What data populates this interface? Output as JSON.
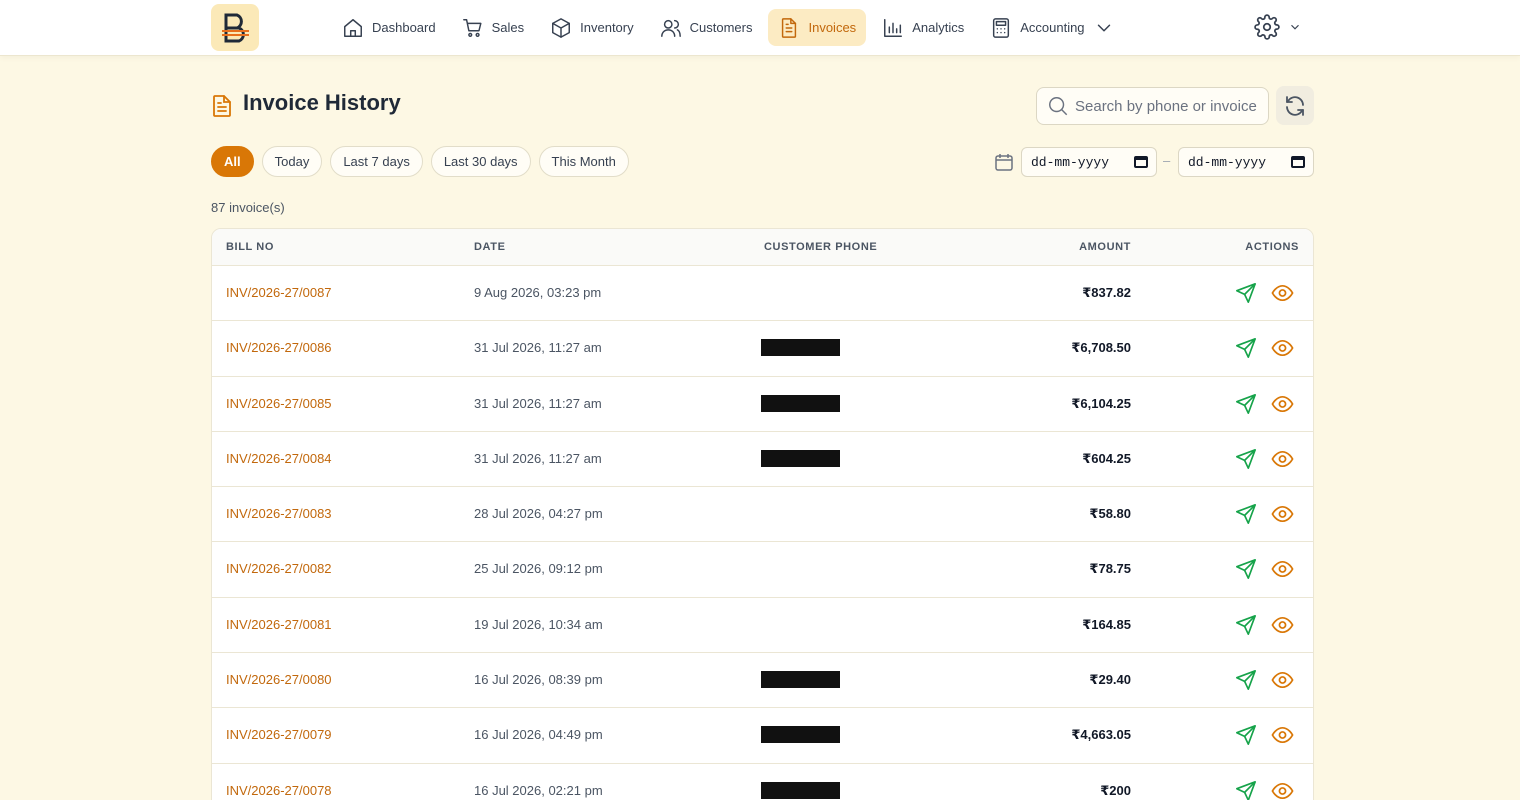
{
  "nav": {
    "items": [
      {
        "label": "Dashboard",
        "icon": "home-icon"
      },
      {
        "label": "Sales",
        "icon": "cart-icon"
      },
      {
        "label": "Inventory",
        "icon": "box-icon"
      },
      {
        "label": "Customers",
        "icon": "users-icon"
      },
      {
        "label": "Invoices",
        "icon": "document-icon",
        "active": true
      },
      {
        "label": "Analytics",
        "icon": "bar-chart-icon"
      },
      {
        "label": "Accounting",
        "icon": "calculator-icon",
        "dropdown": true
      }
    ]
  },
  "header": {
    "title": "Invoice History",
    "search_placeholder": "Search by phone or invoice"
  },
  "filters": {
    "chips": [
      "All",
      "Today",
      "Last 7 days",
      "Last 30 days",
      "This Month"
    ],
    "active": "All",
    "date_from_placeholder": "dd-mm-yyyy",
    "date_to_placeholder": "dd-mm-yyyy",
    "separator": "–"
  },
  "count_label": "87 invoice(s)",
  "table": {
    "columns": [
      "BILL NO",
      "DATE",
      "CUSTOMER PHONE",
      "AMOUNT",
      "ACTIONS"
    ],
    "rows": [
      {
        "bill": "INV/2026-27/0087",
        "date": "9 Aug 2026, 03:23 pm",
        "phone_redacted": false,
        "amount": "₹837.82"
      },
      {
        "bill": "INV/2026-27/0086",
        "date": "31 Jul 2026, 11:27 am",
        "phone_redacted": true,
        "amount": "₹6,708.50"
      },
      {
        "bill": "INV/2026-27/0085",
        "date": "31 Jul 2026, 11:27 am",
        "phone_redacted": true,
        "amount": "₹6,104.25"
      },
      {
        "bill": "INV/2026-27/0084",
        "date": "31 Jul 2026, 11:27 am",
        "phone_redacted": true,
        "amount": "₹604.25"
      },
      {
        "bill": "INV/2026-27/0083",
        "date": "28 Jul 2026, 04:27 pm",
        "phone_redacted": false,
        "amount": "₹58.80"
      },
      {
        "bill": "INV/2026-27/0082",
        "date": "25 Jul 2026, 09:12 pm",
        "phone_redacted": false,
        "amount": "₹78.75"
      },
      {
        "bill": "INV/2026-27/0081",
        "date": "19 Jul 2026, 10:34 am",
        "phone_redacted": false,
        "amount": "₹164.85"
      },
      {
        "bill": "INV/2026-27/0080",
        "date": "16 Jul 2026, 08:39 pm",
        "phone_redacted": true,
        "amount": "₹29.40"
      },
      {
        "bill": "INV/2026-27/0079",
        "date": "16 Jul 2026, 04:49 pm",
        "phone_redacted": true,
        "amount": "₹4,663.05"
      },
      {
        "bill": "INV/2026-27/0078",
        "date": "16 Jul 2026, 02:21 pm",
        "phone_redacted": true,
        "amount": "₹200"
      }
    ]
  },
  "colors": {
    "accent": "#d97706",
    "accent_text": "#c2680c",
    "send_icon": "#16a34a",
    "background": "#fdf8e4"
  }
}
